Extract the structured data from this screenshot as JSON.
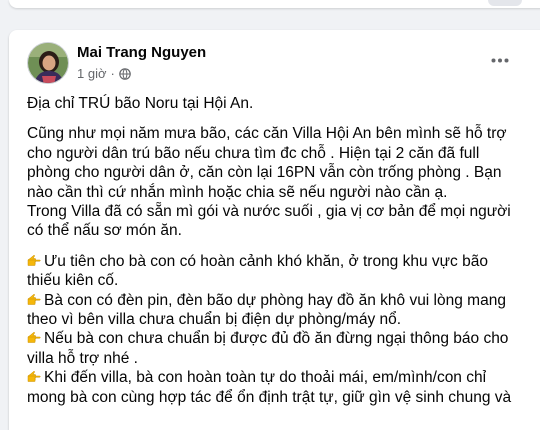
{
  "post": {
    "author": "Mai Trang Nguyen",
    "time": "1 giờ",
    "separator": "·",
    "privacy_icon": "globe-icon",
    "more_icon": "ellipsis-icon",
    "title": "Địa chỉ TRÚ bão Noru tại Hội An.",
    "body_lines": [
      "Cũng như mọi năm mưa bão, các căn Villa Hội An bên mình sẽ hỗ trợ",
      "cho người dân trú bão nếu chưa tìm đc chỗ . Hiện tại 2 căn đã full",
      "phòng cho người dân ở,  căn còn lại 16PN vẫn còn trống phòng . Bạn",
      "nào cần thì cứ nhắn mình hoặc chia sẽ nếu người nào cần ạ.",
      "Trong Villa đã có sẵn mì gói và nước suối , gia vị cơ bản để mọi người",
      "có thể nấu sơ món ăn."
    ],
    "list_lines": [
      {
        "bullet": true,
        "text": "Ưu tiên cho bà con có hoàn cảnh khó khăn, ở trong khu vực bão"
      },
      {
        "bullet": false,
        "text": "thiếu kiên cố."
      },
      {
        "bullet": true,
        "text": "Bà con có đèn pin, đèn bão dự phòng hay đồ ăn khô vui lòng mang"
      },
      {
        "bullet": false,
        "text": "theo vì bên villa chưa chuẩn bị điện dự phòng/máy nổ."
      },
      {
        "bullet": true,
        "text": "Nếu bà con chưa chuẩn bị được đủ đồ ăn đừng ngại thông báo cho"
      },
      {
        "bullet": false,
        "text": "villa hỗ trợ nhé ."
      },
      {
        "bullet": true,
        "text": "Khi đến villa, bà con hoàn toàn tự do thoải mái, em/mình/con chỉ"
      },
      {
        "bullet": false,
        "text": "mong bà con cùng hợp tác để ổn định trật tự, giữ gìn vệ sinh chung và"
      }
    ],
    "bullet_icon": "pointing-hand-icon",
    "colors": {
      "bullet": "#f5b70a",
      "text": "#050505",
      "meta": "#65676b",
      "background": "#f0f2f5"
    }
  }
}
